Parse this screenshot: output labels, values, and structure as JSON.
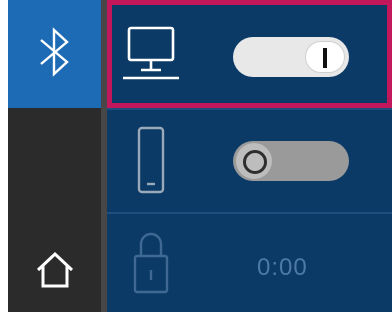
{
  "sidebar": {
    "bluetooth_icon": "bluetooth-icon",
    "home_icon": "home-icon"
  },
  "rows": [
    {
      "icon": "desktop-icon",
      "toggle_state": "on",
      "selected": true
    },
    {
      "icon": "phone-icon",
      "toggle_state": "off",
      "selected": false
    },
    {
      "icon": "lock-icon",
      "time": "0:00",
      "disabled": true
    }
  ],
  "colors": {
    "sidebar_bg": "#2b2b2b",
    "bluetooth_tile": "#1c6bb4",
    "main_bg": "#0b3a66",
    "selection_outline": "#c2185b",
    "toggle_on_track": "#e8e8e8",
    "toggle_off_track": "#9a9a9a"
  }
}
